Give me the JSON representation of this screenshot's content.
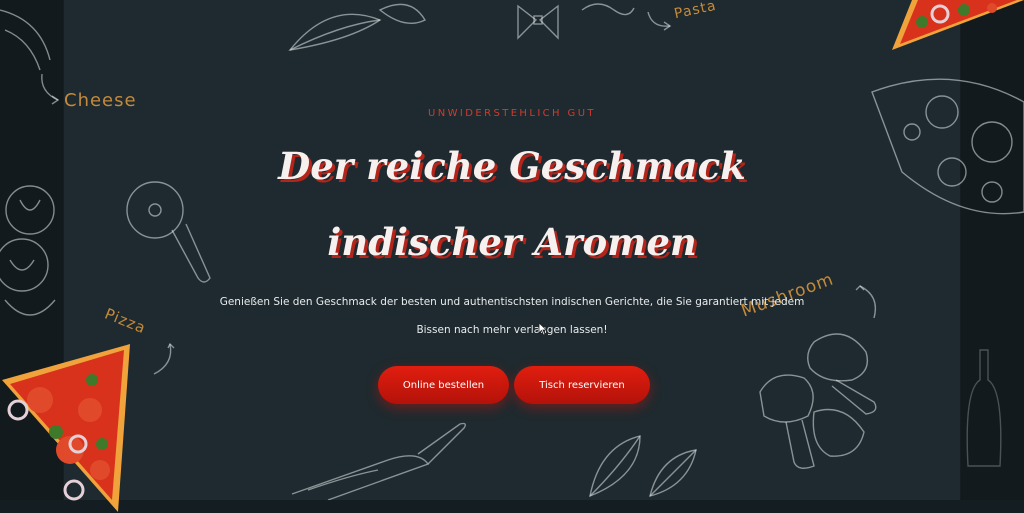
{
  "hero": {
    "eyebrow": "UNWIDERSTEHLICH GUT",
    "headline": "Der reiche Geschmack indischer Aromen",
    "lead": "Genießen Sie den Geschmack der besten und authentischsten indischen Gerichte, die Sie garantiert mit jedem Bissen nach mehr verlangen lassen!",
    "buttons": {
      "order_label": "Online bestellen",
      "reserve_label": "Tisch reservieren"
    }
  },
  "doodle_labels": {
    "cheese": "Cheese",
    "pasta": "Pasta",
    "pizza": "Pizza",
    "mushroom": "Mushroom"
  },
  "colors": {
    "background": "#121a1d",
    "panel": "#1e2a2f",
    "accent_red": "#d33a2c",
    "button_red": "#e01e0f",
    "doodle_label": "#c48a3a",
    "text_light": "#f6f0ee"
  },
  "icons": [
    "cursor-icon",
    "pizza-cutter-icon",
    "pizza-slice-icon",
    "mushroom-icon",
    "basil-leaf-icon",
    "garlic-icon",
    "pasta-bow-icon",
    "knife-icon"
  ]
}
